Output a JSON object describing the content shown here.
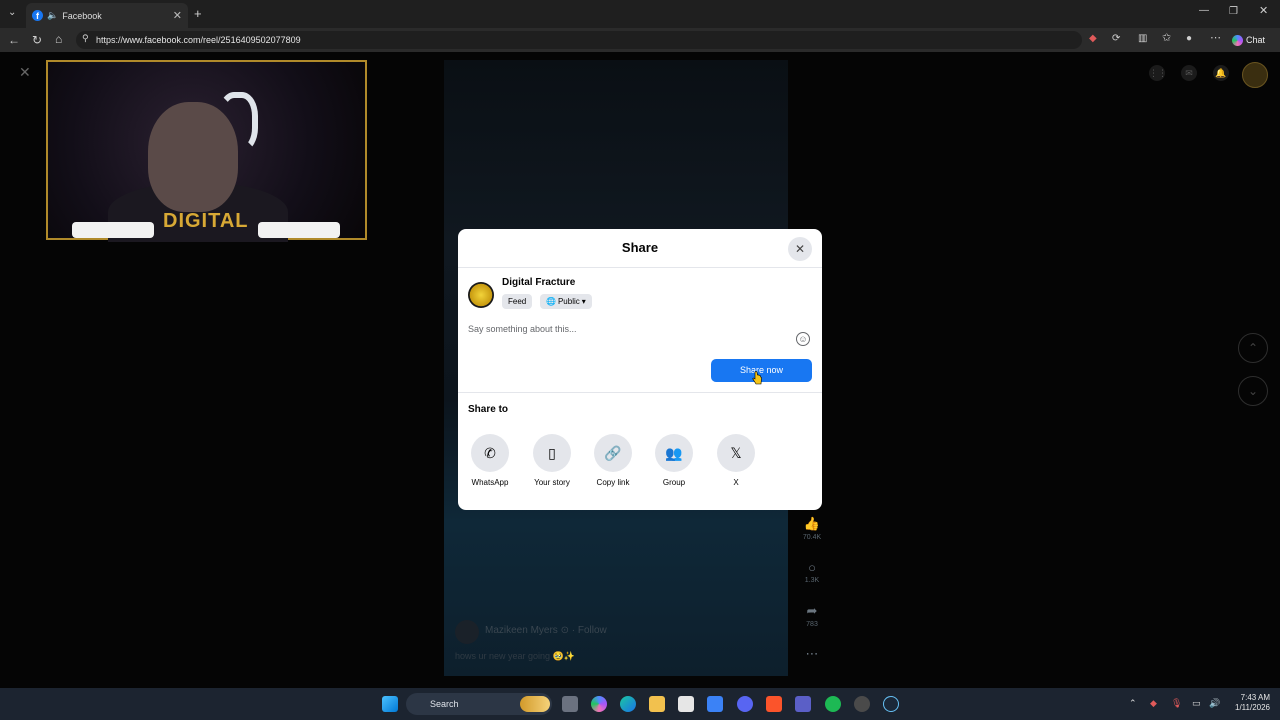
{
  "browser": {
    "tab_title": "Facebook",
    "tab_favicon_letter": "f",
    "tab_speaker_icon": "speaker-icon",
    "url": "https://www.facebook.com/reel/2516409502077809",
    "chat_label": "Chat"
  },
  "webcam": {
    "brand_text": "DIGITAL"
  },
  "reel": {
    "author": "Mazikeen Myers",
    "follow": "Follow",
    "caption": "hows ur new year going",
    "likes": "70.4K",
    "comments": "1.3K",
    "shares": "783"
  },
  "share_dialog": {
    "title": "Share",
    "account_name": "Digital Fracture",
    "feed_label": "Feed",
    "privacy_label": "Public",
    "compose_placeholder": "Say something about this...",
    "share_now_label": "Share now",
    "share_to_title": "Share to",
    "targets": [
      {
        "label": "WhatsApp",
        "icon": "whatsapp-icon"
      },
      {
        "label": "Your story",
        "icon": "story-icon"
      },
      {
        "label": "Copy link",
        "icon": "link-icon"
      },
      {
        "label": "Group",
        "icon": "group-icon"
      },
      {
        "label": "X",
        "icon": "x-logo-icon"
      }
    ]
  },
  "taskbar": {
    "search_label": "Search",
    "time": "7:43 AM",
    "date": "1/11/2026"
  },
  "colors": {
    "facebook_blue": "#1877f2",
    "dialog_bg": "#ffffff",
    "chip_bg": "#e4e6eb",
    "taskbar_bg": "#1c2430"
  }
}
